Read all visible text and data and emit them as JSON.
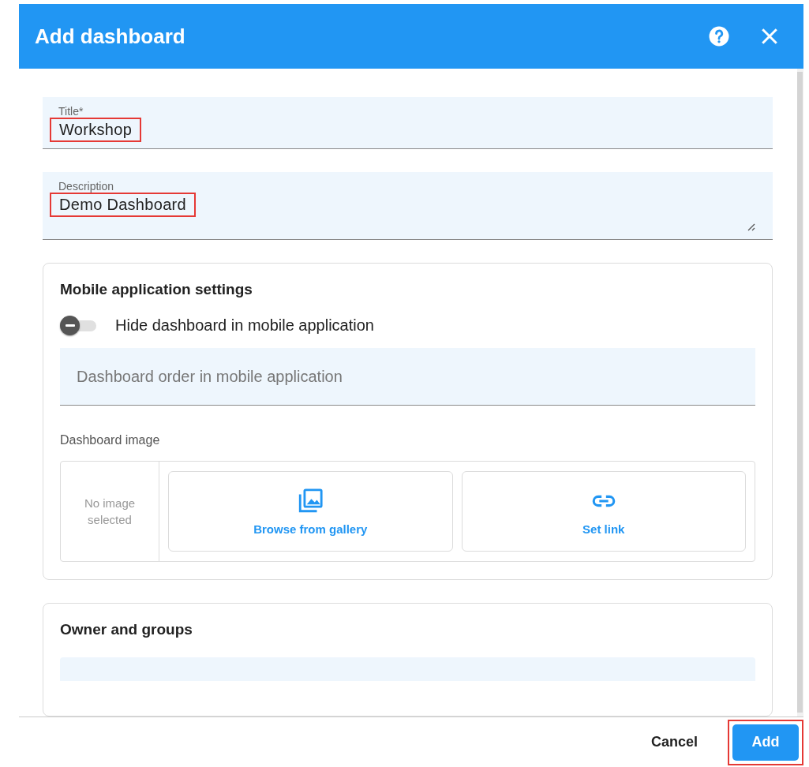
{
  "dialog": {
    "title": "Add dashboard"
  },
  "fields": [
    {
      "kind": "input",
      "label": "Title*",
      "value": "Workshop",
      "highlighted": true
    },
    {
      "kind": "textarea",
      "label": "Description",
      "value": "Demo Dashboard",
      "highlighted": true
    }
  ],
  "mobile_settings": {
    "heading": "Mobile application settings",
    "toggle": {
      "label": "Hide dashboard in mobile application",
      "checked": false
    },
    "order_field": {
      "placeholder": "Dashboard order in mobile application"
    },
    "image": {
      "label": "Dashboard image",
      "preview": "No image selected",
      "actions": [
        {
          "kind": "gallery",
          "label": "Browse from gallery"
        },
        {
          "kind": "link",
          "label": "Set link"
        }
      ]
    }
  },
  "owner_section": {
    "heading": "Owner and groups"
  },
  "footer": {
    "buttons": [
      {
        "kind": "text",
        "label": "Cancel",
        "highlighted": false
      },
      {
        "kind": "primary",
        "label": "Add",
        "highlighted": true
      }
    ]
  }
}
